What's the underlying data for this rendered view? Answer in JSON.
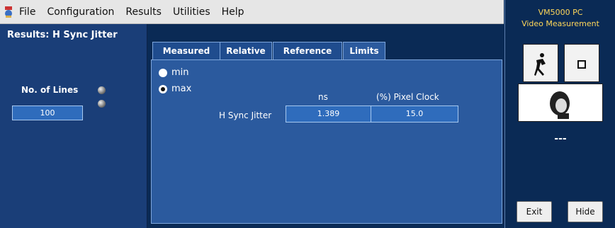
{
  "menu": {
    "items": [
      "File",
      "Configuration",
      "Results",
      "Utilities",
      "Help"
    ]
  },
  "left": {
    "title": "Results: H Sync Jitter",
    "lines_label": "No. of Lines",
    "lines_value": "100"
  },
  "tabs": [
    "Measured",
    "Relative",
    "Reference",
    "Limits"
  ],
  "options": {
    "min_label": "min",
    "max_label": "max",
    "selected": "max"
  },
  "table": {
    "headers": [
      "ns",
      "(%) Pixel Clock"
    ],
    "rows": [
      {
        "label": "H Sync Jitter",
        "values": [
          "1.389",
          "15.0"
        ]
      }
    ]
  },
  "right": {
    "brand_line1": "VM5000 PC",
    "brand_line2": "Video Measurement",
    "status": "---",
    "exit_label": "Exit",
    "hide_label": "Hide"
  },
  "colors": {
    "background": "#0a2a55",
    "panel": "#2b5a9e",
    "brand": "#ffd75a"
  }
}
